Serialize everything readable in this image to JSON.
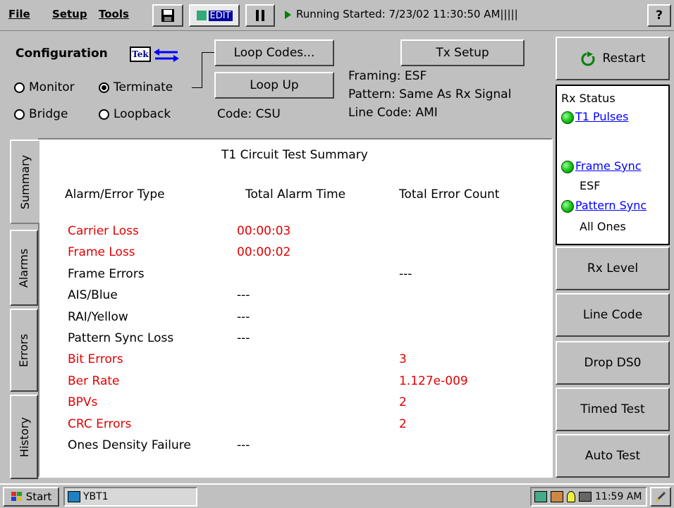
{
  "menubar": {
    "file": "File",
    "setup": "Setup",
    "tools": "Tools",
    "edit_label": "EDIT",
    "status": "Running Started: 7/23/02 11:30:50 AM|||||",
    "help": "?"
  },
  "config": {
    "title": "Configuration",
    "logo_text": "Tek",
    "modes": [
      {
        "label": "Monitor",
        "selected": false
      },
      {
        "label": "Terminate",
        "selected": true
      },
      {
        "label": "Bridge",
        "selected": false
      },
      {
        "label": "Loopback",
        "selected": false
      }
    ],
    "loop_codes_label": "Loop Codes...",
    "loop_up_label": "Loop Up",
    "code": "Code: CSU",
    "tx_setup_label": "Tx Setup",
    "framing": "Framing: ESF",
    "pattern": "Pattern: Same As Rx Signal",
    "line_code": "Line Code:  AMI"
  },
  "tabs": [
    "Summary",
    "Alarms",
    "Errors",
    "History"
  ],
  "summary": {
    "title": "T1 Circuit Test Summary",
    "headers": [
      "Alarm/Error Type",
      "Total Alarm Time",
      "Total Error Count"
    ],
    "rows": [
      {
        "type": "Carrier Loss",
        "alarm_time": "00:00:03",
        "error_count": "",
        "alert": true
      },
      {
        "type": "Frame Loss",
        "alarm_time": "00:00:02",
        "error_count": "",
        "alert": true
      },
      {
        "type": "Frame Errors",
        "alarm_time": "",
        "error_count": "---",
        "alert": false
      },
      {
        "type": "AIS/Blue",
        "alarm_time": "---",
        "error_count": "",
        "alert": false
      },
      {
        "type": "RAI/Yellow",
        "alarm_time": "---",
        "error_count": "",
        "alert": false
      },
      {
        "type": "Pattern Sync Loss",
        "alarm_time": "---",
        "error_count": "",
        "alert": false
      },
      {
        "type": "Bit Errors",
        "alarm_time": "",
        "error_count": "3",
        "alert": true
      },
      {
        "type": "Ber Rate",
        "alarm_time": "",
        "error_count": "1.127e-009",
        "alert": true
      },
      {
        "type": "BPVs",
        "alarm_time": "",
        "error_count": "2",
        "alert": true
      },
      {
        "type": "CRC Errors",
        "alarm_time": "",
        "error_count": "2",
        "alert": true
      },
      {
        "type": "Ones Density Failure",
        "alarm_time": "---",
        "error_count": "",
        "alert": false
      }
    ]
  },
  "right": {
    "restart_label": "Restart",
    "rx_status_title": "Rx Status",
    "t1_pulses": "T1 Pulses",
    "frame_sync": "Frame Sync",
    "frame_sync_value": "ESF",
    "pattern_sync": "Pattern Sync",
    "pattern_sync_value": "All Ones",
    "buttons": [
      "Rx Level",
      "Line Code",
      "Drop DS0",
      "Timed Test",
      "Auto Test"
    ]
  },
  "taskbar": {
    "start_label": "Start",
    "task_label": "YBT1",
    "clock": "11:59 AM"
  },
  "colors": {
    "alert": "#e00000",
    "link": "#0000ff",
    "led": "#22cc22",
    "face": "#c0c0c0"
  }
}
